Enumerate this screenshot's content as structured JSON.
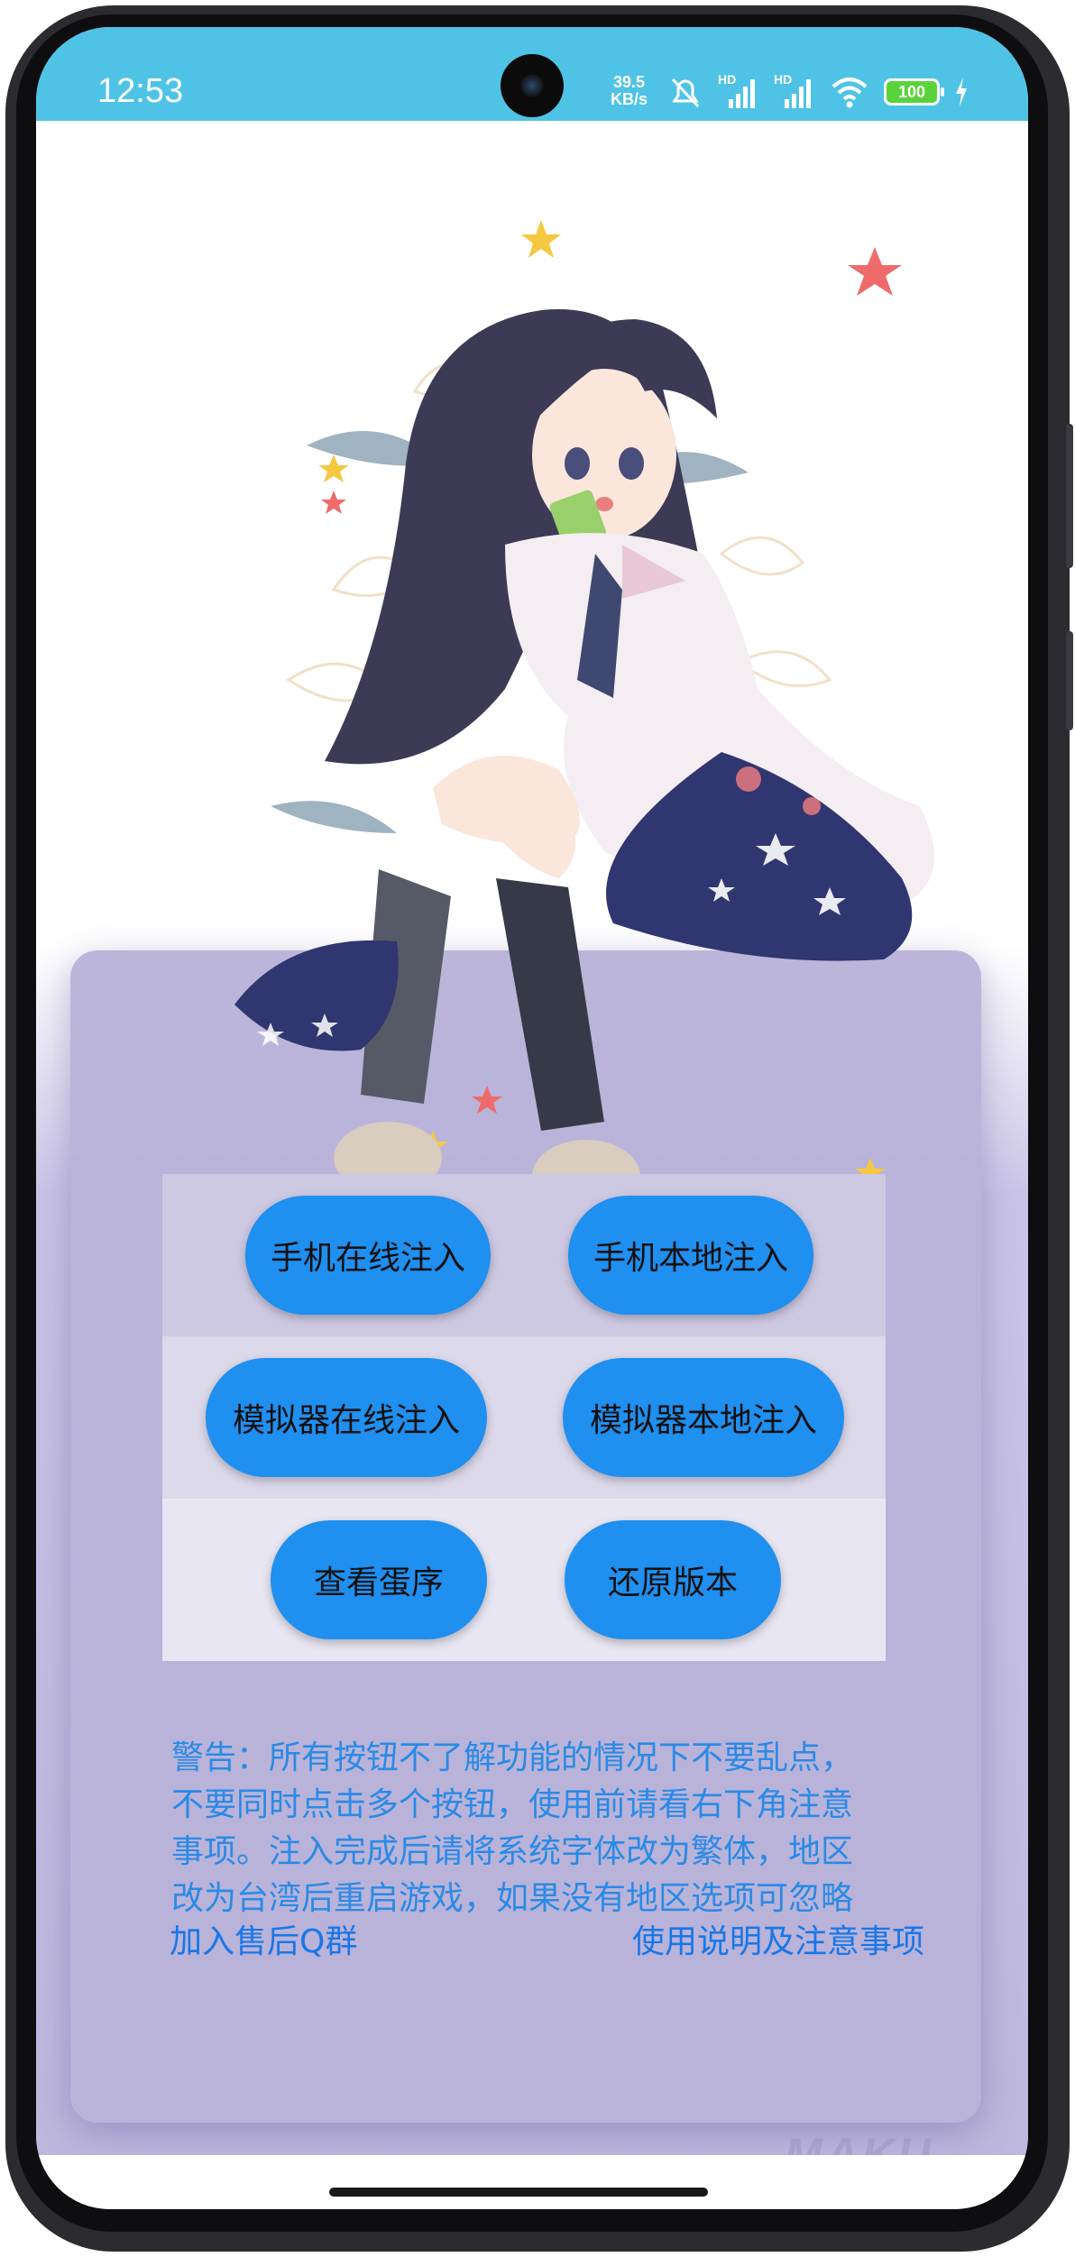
{
  "status_bar": {
    "time": "12:53",
    "net_speed_value": "39.5",
    "net_speed_unit": "KB/s",
    "signal_1_label": "HD",
    "signal_2_label": "HD",
    "battery_level": "100",
    "background_color": "#4fc3e6"
  },
  "buttons": {
    "phone_online_inject": "手机在线注入",
    "phone_local_inject": "手机本地注入",
    "emulator_online_inject": "模拟器在线注入",
    "emulator_local_inject": "模拟器本地注入",
    "view_egg_sequence": "查看蛋序",
    "restore_version": "还原版本"
  },
  "warning_text": "警告：所有按钮不了解功能的情况下不要乱点，不要同时点击多个按钮，使用前请看右下角注意事项。注入完成后请将系统字体改为繁体，地区改为台湾后重启游戏，如果没有地区选项可忽略",
  "links": {
    "join_qq_group": "加入售后Q群",
    "usage_notes": "使用说明及注意事项"
  },
  "watermark": "MAKU",
  "colors": {
    "button": "#1f8ff0",
    "warning_text": "#2a8ae6",
    "link": "#1777e8",
    "panel": "#b8b2d8"
  },
  "illustration": {
    "subject": "anime-girl-sitting-illustration"
  }
}
